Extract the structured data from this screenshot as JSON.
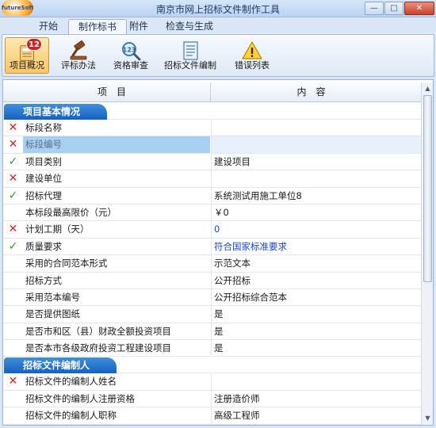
{
  "window": {
    "title": "南京市网上招标文件制作工具",
    "logo_text": "futureSoft",
    "minimize": "—",
    "maximize": "□",
    "close": "✕"
  },
  "tabs": [
    {
      "label": "开始"
    },
    {
      "label": "制作标书"
    },
    {
      "label": "附件"
    },
    {
      "label": "检查与生成"
    }
  ],
  "ribbon": [
    {
      "label": "项目概况",
      "badge": "12",
      "icon": "project-overview-icon"
    },
    {
      "label": "评标办法",
      "icon": "gavel-icon"
    },
    {
      "label": "资格审查",
      "icon": "magnifier-icon"
    },
    {
      "label": "招标文件编制",
      "icon": "document-icon"
    },
    {
      "label": "错误列表",
      "icon": "warning-icon"
    }
  ],
  "grid": {
    "col_item": "项目",
    "col_content": "内容",
    "section1": "项目基本情况",
    "section2": "招标文件编制人",
    "rows1": [
      {
        "status": "x",
        "item": "标段名称",
        "value": ""
      },
      {
        "status": "x",
        "item": "标段编号",
        "value": ""
      },
      {
        "status": "ok",
        "item": "项目类别",
        "value": "建设项目"
      },
      {
        "status": "x",
        "item": "建设单位",
        "value": ""
      },
      {
        "status": "ok",
        "item": "招标代理",
        "value": "系统测试用施工单位8"
      },
      {
        "status": "",
        "item": "本标段最高限价（元）",
        "value": "￥0"
      },
      {
        "status": "x",
        "item": "计划工期（天）",
        "value": "0"
      },
      {
        "status": "ok",
        "item": "质量要求",
        "value": "符合国家标准要求"
      },
      {
        "status": "",
        "item": "采用的合同范本形式",
        "value": "示范文本"
      },
      {
        "status": "",
        "item": "招标方式",
        "value": "公开招标"
      },
      {
        "status": "",
        "item": "采用范本编号",
        "value": "公开招标综合范本"
      },
      {
        "status": "",
        "item": "是否提供图纸",
        "value": "是"
      },
      {
        "status": "",
        "item": "是否市和区（县）财政全额投资项目",
        "value": "是"
      },
      {
        "status": "",
        "item": "是否本市各级政府投资工程建设项目",
        "value": "是"
      }
    ],
    "rows2": [
      {
        "status": "x",
        "item": "招标文件的编制人姓名",
        "value": ""
      },
      {
        "status": "",
        "item": "招标文件的编制人注册资格",
        "value": "注册造价师"
      },
      {
        "status": "",
        "item": "招标文件的编制人职称",
        "value": "高级工程师"
      }
    ],
    "marks": {
      "x": "✕",
      "ok": "✓"
    }
  },
  "colors": {
    "accent": "#1562bf",
    "error": "#d62323",
    "ok": "#2f9a2f",
    "selection": "#a8d0f2",
    "value_blue": "#1d44c9"
  }
}
